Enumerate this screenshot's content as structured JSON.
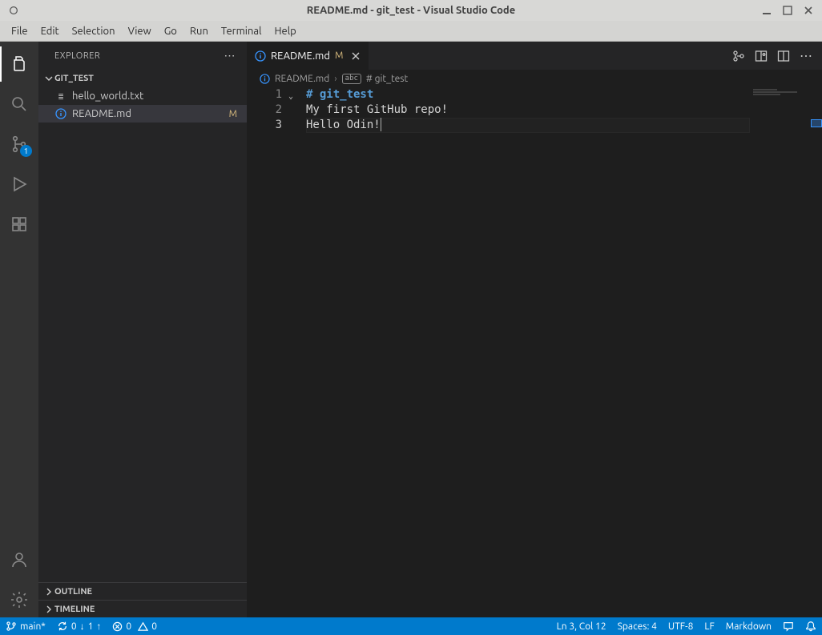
{
  "window": {
    "title": "README.md - git_test - Visual Studio Code"
  },
  "menu": {
    "items": [
      "File",
      "Edit",
      "Selection",
      "View",
      "Go",
      "Run",
      "Terminal",
      "Help"
    ]
  },
  "activity": {
    "scm_badge": "1"
  },
  "sidebar": {
    "title": "EXPLORER",
    "folder": "GIT_TEST",
    "files": [
      {
        "name": "hello_world.txt",
        "icon": "text",
        "modified": false
      },
      {
        "name": "README.md",
        "icon": "info",
        "modified": true,
        "mod_label": "M"
      }
    ],
    "sections": {
      "outline": "OUTLINE",
      "timeline": "TIMELINE"
    }
  },
  "tabs": {
    "active": {
      "icon": "info",
      "label": "README.md",
      "status": "M"
    }
  },
  "breadcrumb": {
    "file_icon": "info",
    "file": "README.md",
    "symbol_icon": "md",
    "symbol": "# git_test"
  },
  "editor": {
    "line_numbers": [
      "1",
      "2",
      "3"
    ],
    "lines": {
      "l1": "# git_test",
      "l2": "My first GitHub repo!",
      "l3": "Hello Odin!"
    }
  },
  "status": {
    "branch": "main*",
    "sync_down": "0",
    "sync_up": "1",
    "errors": "0",
    "warnings": "0",
    "cursor": "Ln 3, Col 12",
    "spaces": "Spaces: 4",
    "encoding": "UTF-8",
    "eol": "LF",
    "language": "Markdown"
  }
}
